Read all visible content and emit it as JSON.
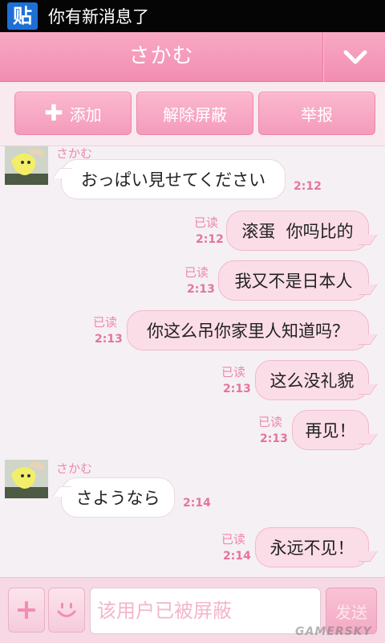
{
  "status_bar": {
    "app_icon_glyph": "贴",
    "notification": "你有新消息了"
  },
  "header": {
    "title": "さかむ",
    "collapse_icon": "chevron-down-icon"
  },
  "actions": {
    "add_label": "添加",
    "unblock_label": "解除屏蔽",
    "report_label": "举报"
  },
  "messages": [
    {
      "direction": "in",
      "sender": "さかむ",
      "text": "おっぱい見せてください",
      "time": "2:12"
    },
    {
      "direction": "out",
      "status": "已读",
      "text": "滚蛋  你吗比的",
      "time": "2:12"
    },
    {
      "direction": "out",
      "status": "已读",
      "text": "我又不是日本人",
      "time": "2:13"
    },
    {
      "direction": "out",
      "status": "已读",
      "text": "你这么吊你家里人知道吗？",
      "time": "2:13"
    },
    {
      "direction": "out",
      "status": "已读",
      "text": "这么没礼貌",
      "time": "2:13"
    },
    {
      "direction": "out",
      "status": "已读",
      "text": "再见！",
      "time": "2:13"
    },
    {
      "direction": "in",
      "sender": "さかむ",
      "text": "さようなら",
      "time": "2:14"
    },
    {
      "direction": "out",
      "status": "已读",
      "text": "永远不见！",
      "time": "2:14"
    }
  ],
  "input": {
    "placeholder": "该用户已被屏蔽",
    "send_label": "发送"
  },
  "watermark": "GAMERSKY",
  "colors": {
    "accent_pink": "#f28db2",
    "bubble_out": "#fbdde8",
    "bubble_in": "#ffffff",
    "status_bar": "#050505"
  }
}
